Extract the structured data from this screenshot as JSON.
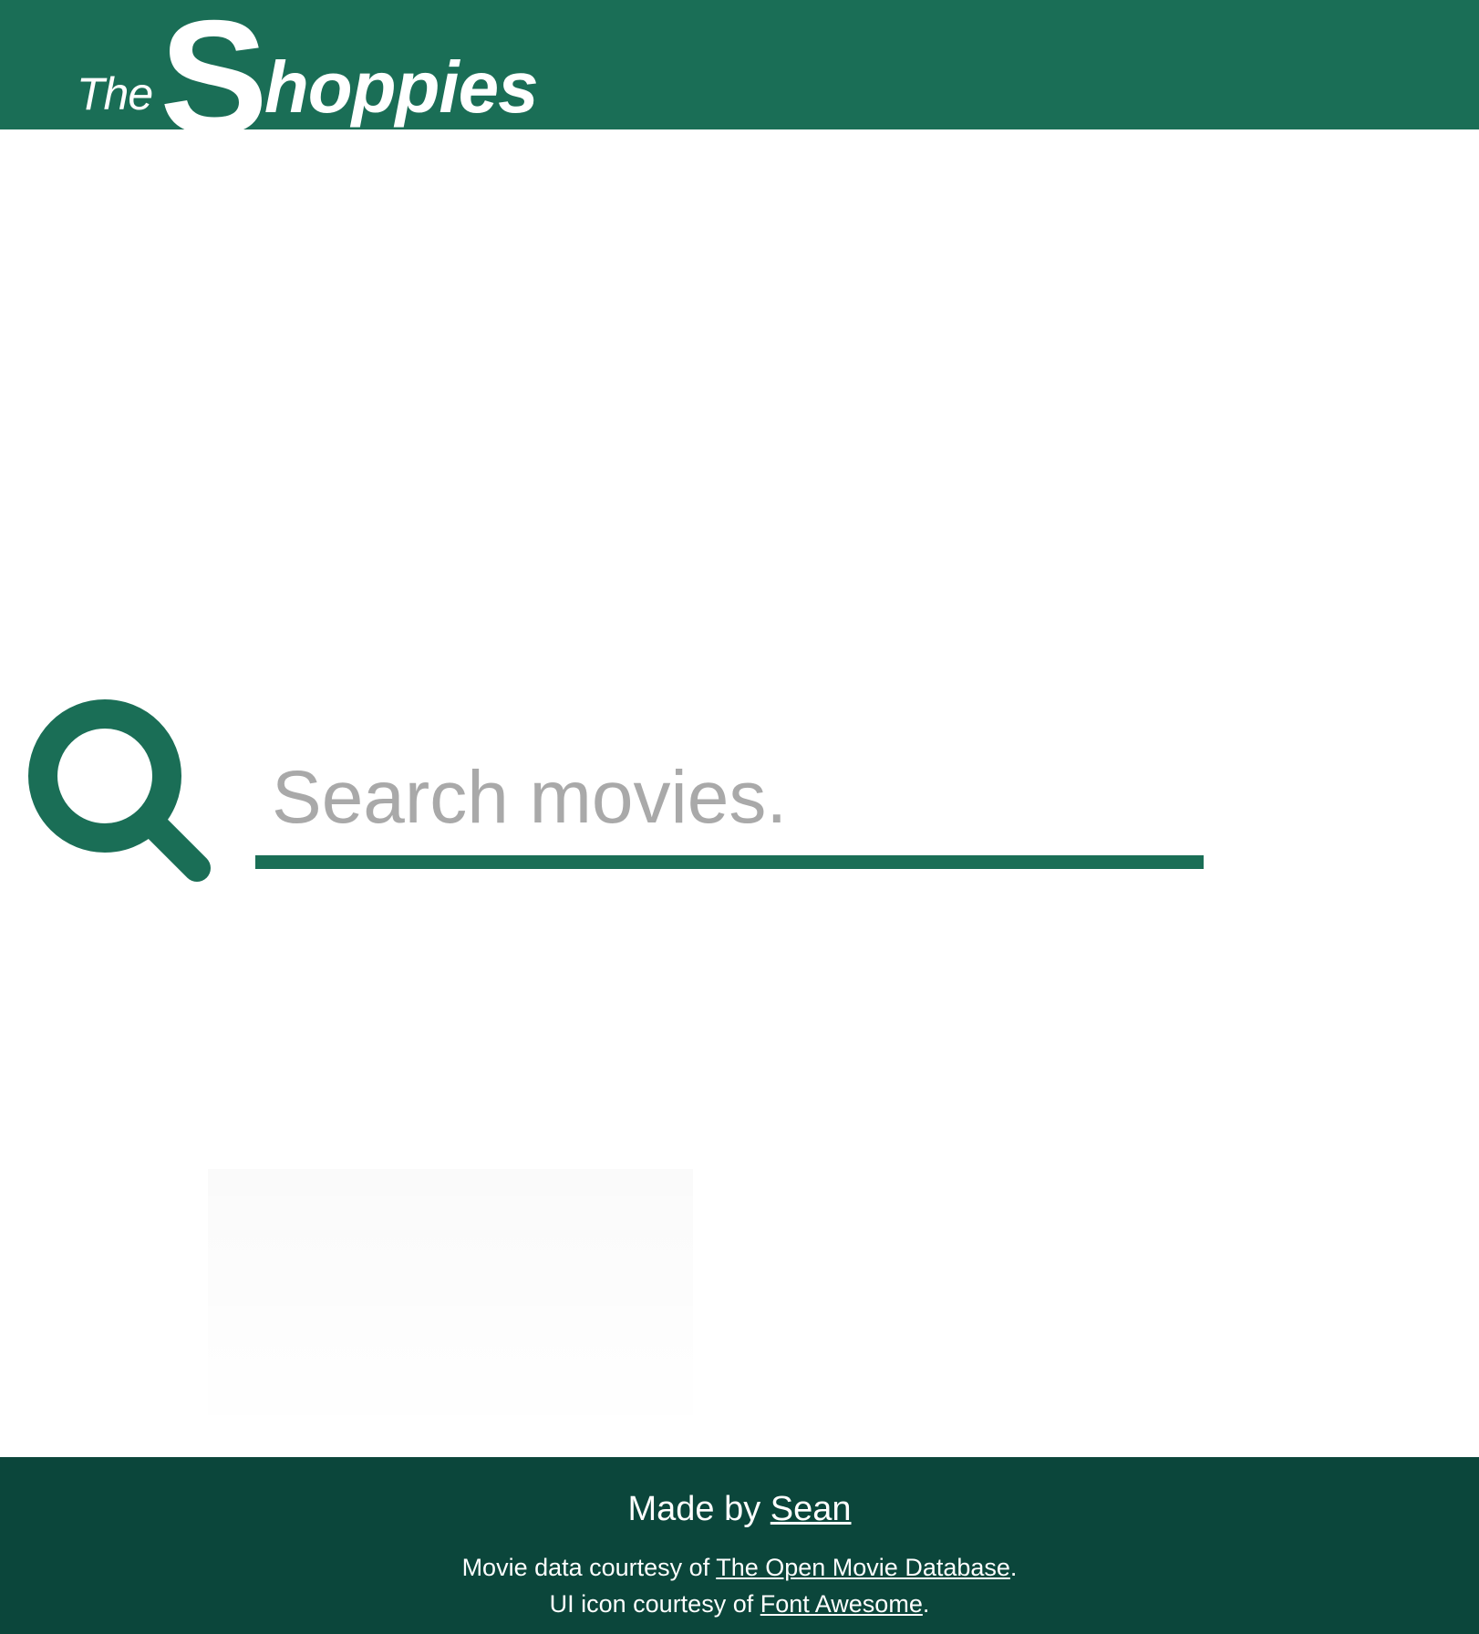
{
  "colors": {
    "brand_green": "#1a6e56",
    "footer_green": "#0b463b",
    "placeholder_gray": "#a9a9a9"
  },
  "header": {
    "logo": {
      "the": "The",
      "s": "S",
      "rest": "hoppies"
    }
  },
  "search": {
    "icon": "search-icon",
    "placeholder": "Search movies.",
    "value": ""
  },
  "footer": {
    "made_by_prefix": "Made by ",
    "made_by_link": "Sean",
    "credit1_prefix": "Movie data courtesy of ",
    "credit1_link": "The Open Movie Database",
    "credit1_suffix": ".",
    "credit2_prefix": "UI icon courtesy of ",
    "credit2_link": "Font Awesome",
    "credit2_suffix": "."
  }
}
